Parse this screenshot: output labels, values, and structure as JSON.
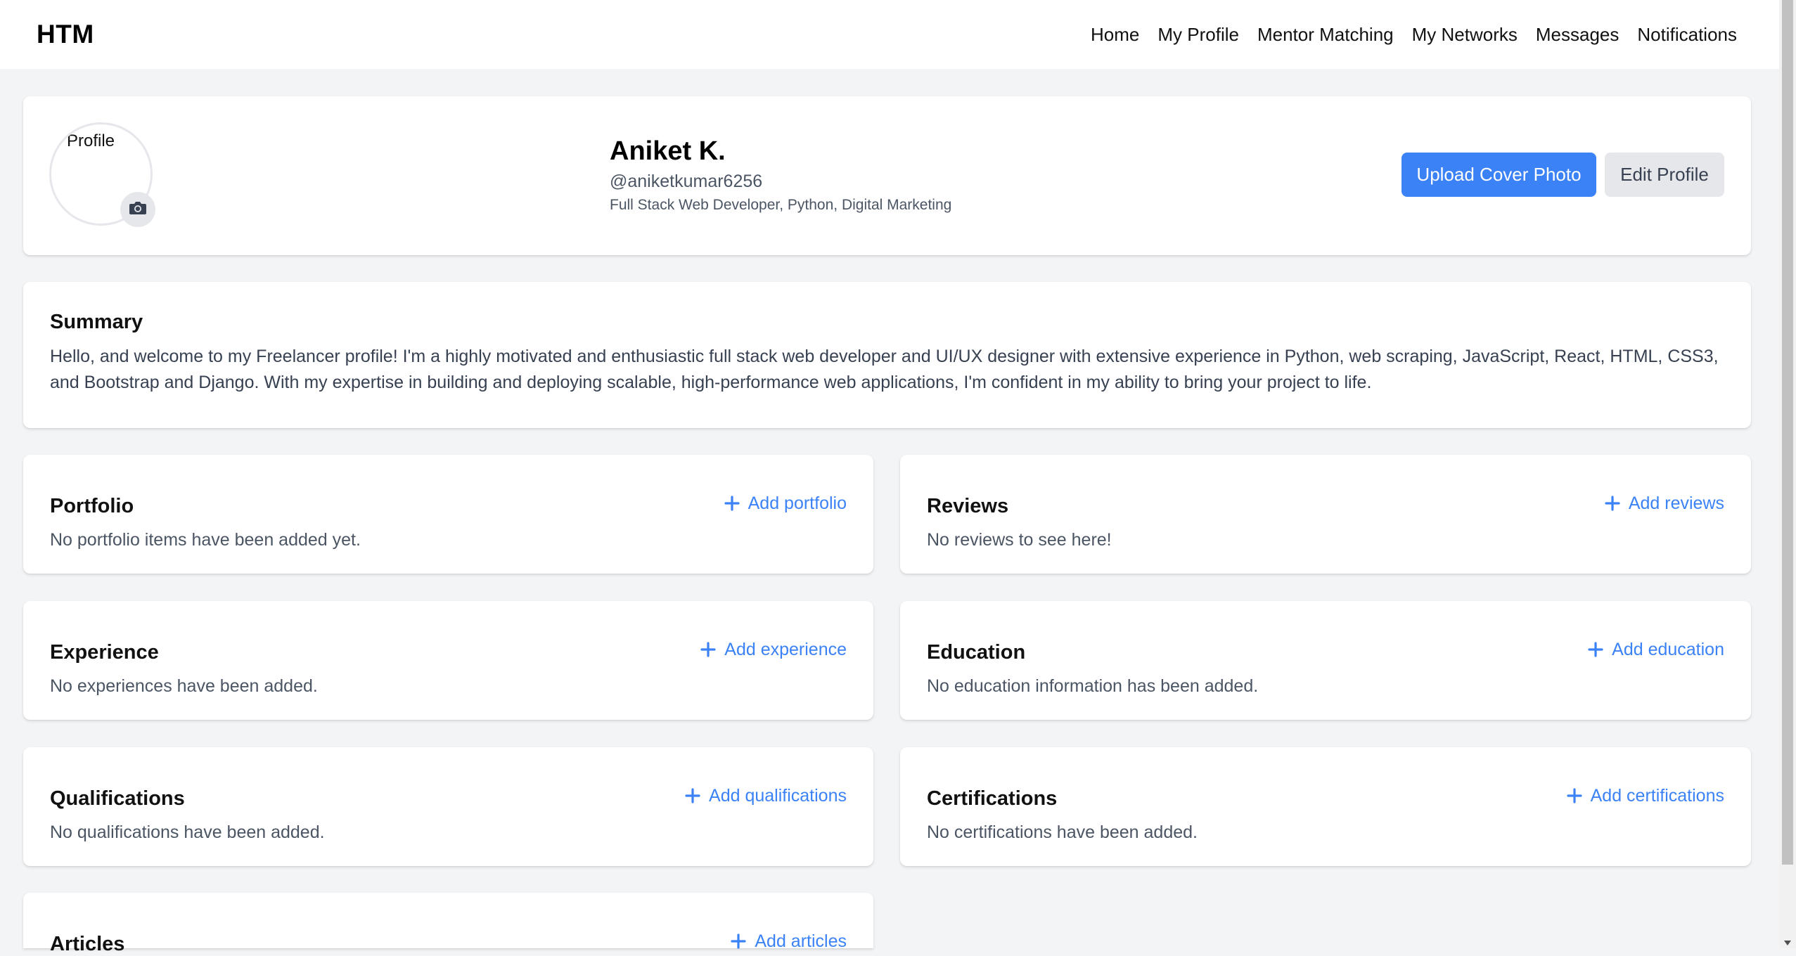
{
  "nav": {
    "logo": "HTM",
    "links": [
      "Home",
      "My Profile",
      "Mentor Matching",
      "My Networks",
      "Messages",
      "Notifications"
    ]
  },
  "profile": {
    "avatar_alt": "Profile",
    "name": "Aniket K.",
    "handle": "@aniketkumar6256",
    "headline": "Full Stack Web Developer, Python, Digital Marketing",
    "upload_cover_label": "Upload Cover Photo",
    "edit_profile_label": "Edit Profile"
  },
  "summary": {
    "title": "Summary",
    "text": "Hello, and welcome to my Freelancer profile! I'm a highly motivated and enthusiastic full stack web developer and UI/UX designer with extensive experience in Python, web scraping, JavaScript, React, HTML, CSS3, and Bootstrap and Django. With my expertise in building and deploying scalable, high-performance web applications, I'm confident in my ability to bring your project to life."
  },
  "sections": {
    "portfolio": {
      "title": "Portfolio",
      "add_label": "Add portfolio",
      "empty": "No portfolio items have been added yet."
    },
    "reviews": {
      "title": "Reviews",
      "add_label": "Add reviews",
      "empty": "No reviews to see here!"
    },
    "experience": {
      "title": "Experience",
      "add_label": "Add experience",
      "empty": "No experiences have been added."
    },
    "education": {
      "title": "Education",
      "add_label": "Add education",
      "empty": "No education information has been added."
    },
    "qualifications": {
      "title": "Qualifications",
      "add_label": "Add qualifications",
      "empty": "No qualifications have been added."
    },
    "certifications": {
      "title": "Certifications",
      "add_label": "Add certifications",
      "empty": "No certifications have been added."
    },
    "articles": {
      "title": "Articles",
      "add_label": "Add articles"
    }
  },
  "icons": {
    "camera": "camera-icon",
    "plus": "plus-icon"
  },
  "colors": {
    "accent": "#3b82f6",
    "background": "#f3f4f6",
    "card": "#ffffff",
    "secondary_button": "#e5e7eb"
  }
}
